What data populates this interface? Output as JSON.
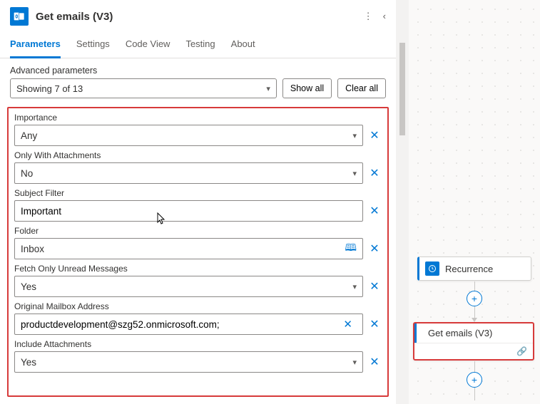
{
  "header": {
    "title": "Get emails (V3)"
  },
  "tabs": [
    {
      "label": "Parameters",
      "active": true
    },
    {
      "label": "Settings"
    },
    {
      "label": "Code View"
    },
    {
      "label": "Testing"
    },
    {
      "label": "About"
    }
  ],
  "advanced": {
    "label": "Advanced parameters",
    "showing": "Showing 7 of 13",
    "show_all": "Show all",
    "clear_all": "Clear all"
  },
  "params": {
    "importance": {
      "label": "Importance",
      "value": "Any"
    },
    "only_attachments": {
      "label": "Only With Attachments",
      "value": "No"
    },
    "subject_filter": {
      "label": "Subject Filter",
      "value": "Important"
    },
    "folder": {
      "label": "Folder",
      "value": "Inbox"
    },
    "fetch_unread": {
      "label": "Fetch Only Unread Messages",
      "value": "Yes"
    },
    "mailbox": {
      "label": "Original Mailbox Address",
      "value": "productdevelopment@szg52.onmicrosoft.com;"
    },
    "include_attachments": {
      "label": "Include Attachments",
      "value": "Yes"
    }
  },
  "canvas": {
    "recurrence": {
      "label": "Recurrence"
    },
    "get_emails": {
      "label": "Get emails (V3)"
    }
  }
}
